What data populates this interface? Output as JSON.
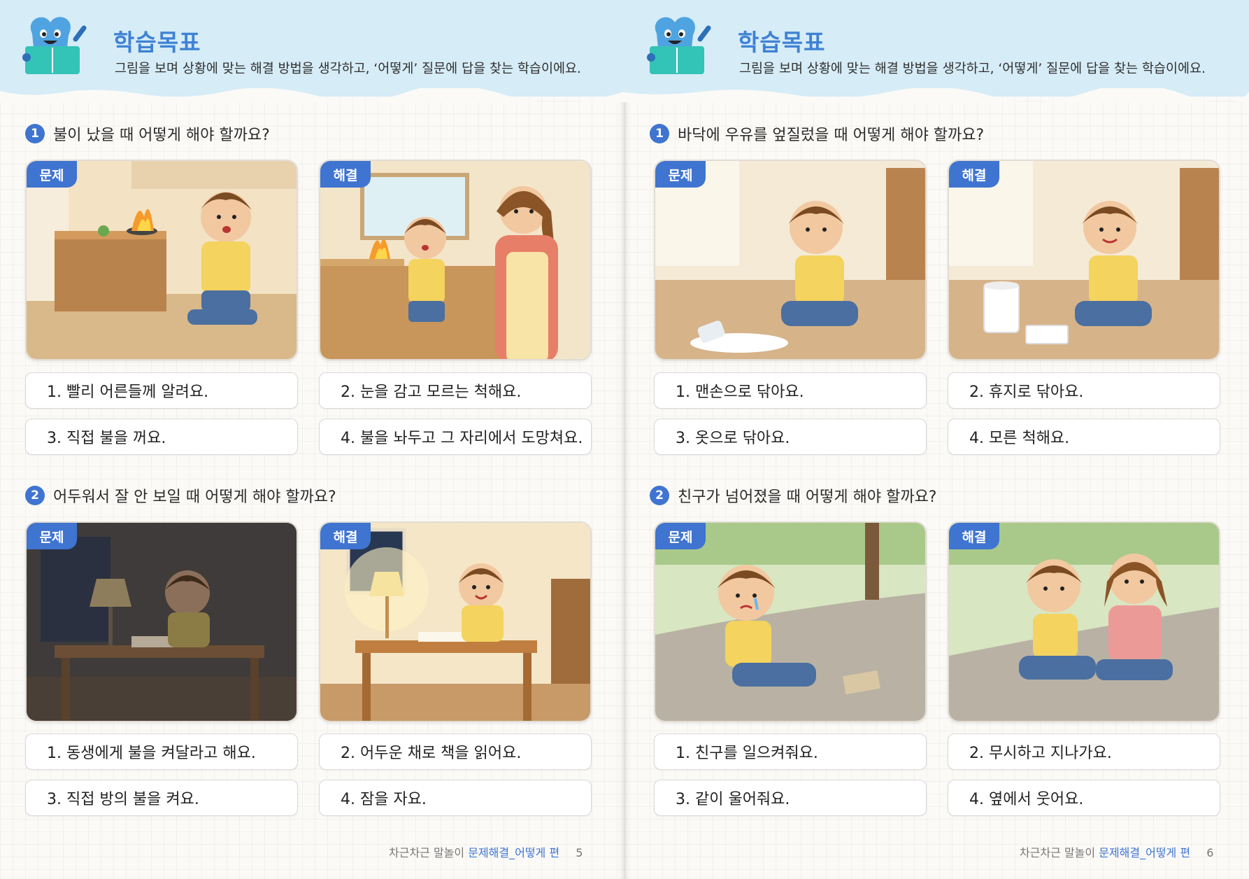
{
  "pages": [
    {
      "goal_title": "학습목표",
      "goal_desc": "그림을 보며 상황에 맞는 해결 방법을 생각하고, ‘어떻게’ 질문에 답을 찾는 학습이에요.",
      "questions": [
        {
          "num": "1",
          "text": "불이 났을 때 어떻게 해야 할까요?",
          "problem_tag": "문제",
          "solution_tag": "해결",
          "problem_image": "child-kitchen-fire",
          "solution_image": "child-tells-mother-fire",
          "options": [
            "1. 빨리 어른들께 알려요.",
            "2. 눈을 감고 모르는 척해요.",
            "3. 직접 불을 꺼요.",
            "4. 불을 놔두고 그 자리에서 도망쳐요."
          ]
        },
        {
          "num": "2",
          "text": "어두워서 잘 안 보일 때 어떻게 해야 할까요?",
          "problem_tag": "문제",
          "solution_tag": "해결",
          "problem_image": "child-dark-room-desk",
          "solution_image": "child-lit-lamp-reading",
          "options": [
            "1. 동생에게 불을 켜달라고 해요.",
            "2. 어두운 채로 책을 읽어요.",
            "3. 직접 방의 불을 켜요.",
            "4. 잠을 자요."
          ]
        }
      ],
      "footer": {
        "series": "차근차근 말놀이",
        "title": "문제해결_어떻게 편",
        "page": "5"
      }
    },
    {
      "goal_title": "학습목표",
      "goal_desc": "그림을 보며 상황에 맞는 해결 방법을 생각하고, ‘어떻게’ 질문에 답을 찾는 학습이에요.",
      "questions": [
        {
          "num": "1",
          "text": "바닥에 우유를 엎질렀을 때 어떻게 해야 할까요?",
          "problem_tag": "문제",
          "solution_tag": "해결",
          "problem_image": "child-spilled-milk",
          "solution_image": "child-wiping-with-tissue",
          "options": [
            "1. 맨손으로 닦아요.",
            "2. 휴지로 닦아요.",
            "3. 옷으로 닦아요.",
            "4. 모른 척해요."
          ]
        },
        {
          "num": "2",
          "text": "친구가 넘어졌을 때 어떻게 해야 할까요?",
          "problem_tag": "문제",
          "solution_tag": "해결",
          "problem_image": "child-fallen-crying-park",
          "solution_image": "friend-helping-child-park",
          "options": [
            "1. 친구를 일으켜줘요.",
            "2. 무시하고 지나가요.",
            "3. 같이 울어줘요.",
            "4. 옆에서 웃어요."
          ]
        }
      ],
      "footer": {
        "series": "차근차근 말놀이",
        "title": "문제해결_어떻게 편",
        "page": "6"
      }
    }
  ],
  "colors": {
    "accent": "#3f74d0",
    "title": "#3f82d4",
    "banner": "#d6ecf7"
  }
}
